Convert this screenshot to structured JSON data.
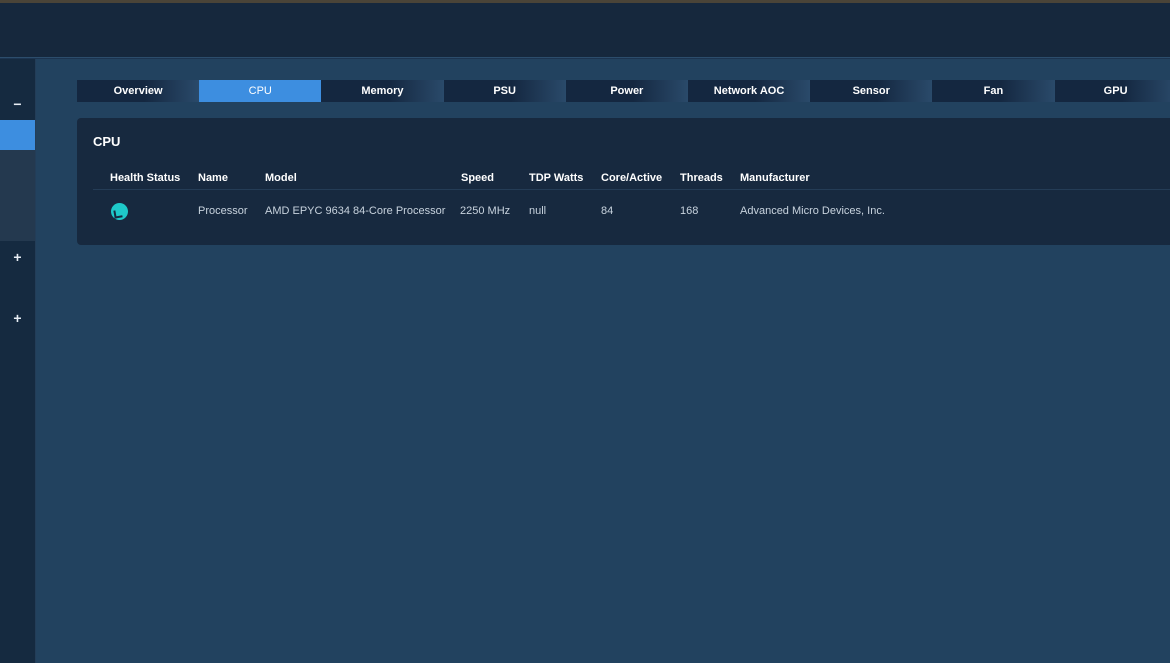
{
  "sidebar": {
    "collapse_symbol": "−",
    "expand_symbol_1": "+",
    "expand_symbol_2": "+"
  },
  "tabs": [
    {
      "label": "Overview"
    },
    {
      "label": "CPU"
    },
    {
      "label": "Memory"
    },
    {
      "label": "PSU"
    },
    {
      "label": "Power"
    },
    {
      "label": "Network AOC"
    },
    {
      "label": "Sensor"
    },
    {
      "label": "Fan"
    },
    {
      "label": "GPU"
    }
  ],
  "active_tab": "CPU",
  "card": {
    "title": "CPU",
    "columns": [
      "Health Status",
      "Name",
      "Model",
      "Speed",
      "TDP Watts",
      "Core/Active",
      "Threads",
      "Manufacturer"
    ],
    "rows": [
      {
        "health_icon": "health-ok-icon",
        "name": "Processor",
        "model": "AMD EPYC 9634 84-Core Processor",
        "speed": "2250 MHz",
        "tdp_watts": "null",
        "core_active": "84",
        "threads": "168",
        "manufacturer": "Advanced Micro Devices, Inc."
      }
    ]
  },
  "colors": {
    "accent": "#3d8ee0",
    "health_ok": "#1ec9c9",
    "background": "#22425f",
    "card": "#17293f"
  }
}
